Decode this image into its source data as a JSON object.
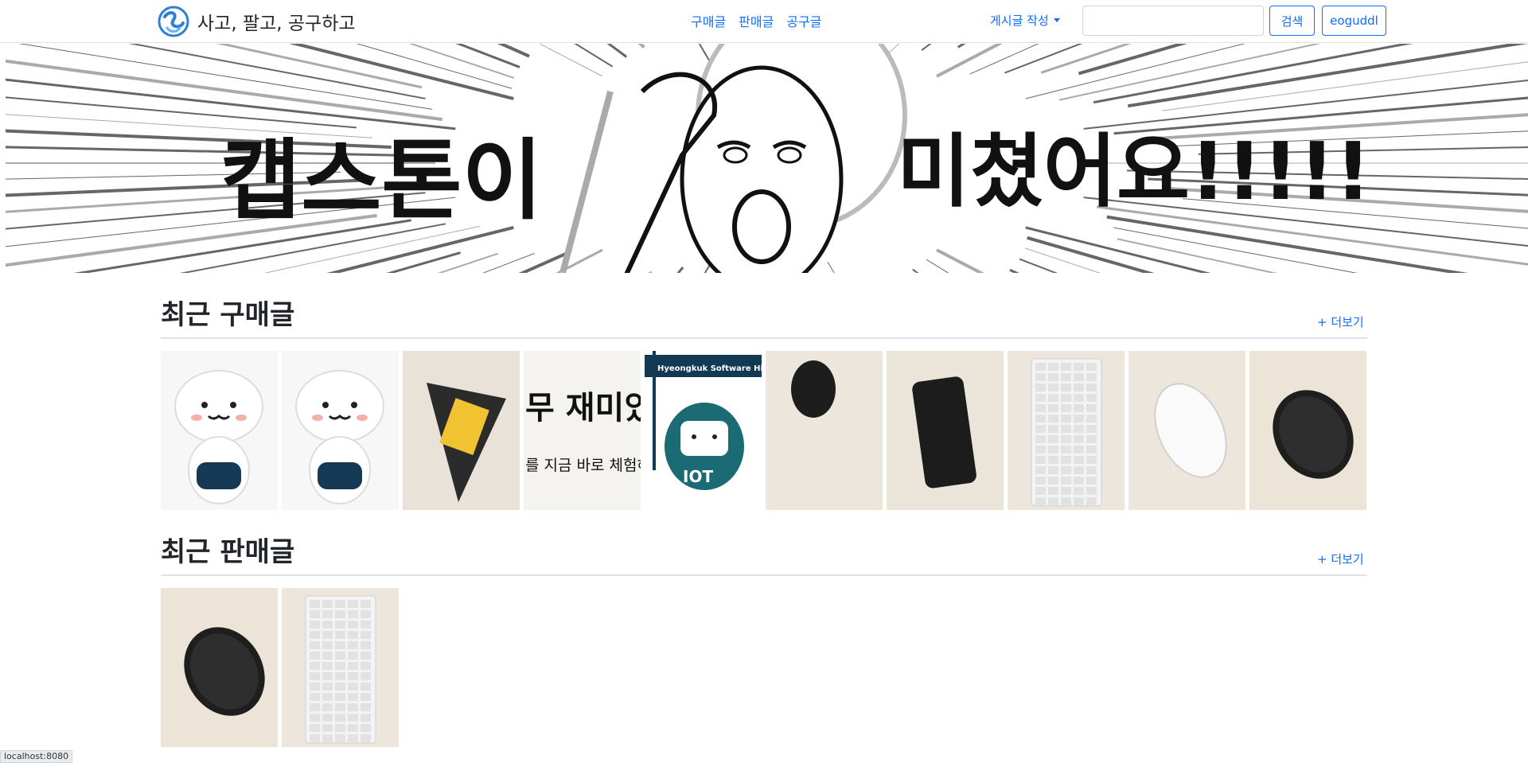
{
  "navbar": {
    "brand_name": "사고, 팔고, 공구하고",
    "links": [
      "구매글",
      "판매글",
      "공구글"
    ],
    "write_dropdown": "게시글 작성",
    "search_placeholder": "",
    "search_button": "검색",
    "user_button": "eoguddl"
  },
  "banner": {
    "text_left": "캡스톤이",
    "text_right": "미쳤어요!!!!!"
  },
  "sections": [
    {
      "title": "최근 구매글",
      "more": "+ 더보기",
      "items": [
        {
          "icon": "robot-mascot-image"
        },
        {
          "icon": "robot-mascot-image"
        },
        {
          "icon": "triangle-kimbap-image"
        },
        {
          "icon": "software-poster-image",
          "text_top": "무 재미있",
          "text_bottom": "를 지금 바로 체험하"
        },
        {
          "icon": "iot-robot-flag-image",
          "text_banner": "Hyeongkuk Software High S",
          "text_iot": "IOT"
        },
        {
          "icon": "black-mouse-image"
        },
        {
          "icon": "smartphone-image"
        },
        {
          "icon": "white-keyboard-image"
        },
        {
          "icon": "white-magic-mouse-image"
        },
        {
          "icon": "black-mouse-angled-image"
        }
      ]
    },
    {
      "title": "최근 판매글",
      "more": "+ 더보기",
      "items": [
        {
          "icon": "black-mouse-angled-image"
        },
        {
          "icon": "white-keyboard-image"
        }
      ]
    }
  ],
  "statusbar": {
    "url": "localhost:8080"
  },
  "colors": {
    "link": "#0d6efd",
    "text": "#212529",
    "border": "#dee2e6"
  }
}
